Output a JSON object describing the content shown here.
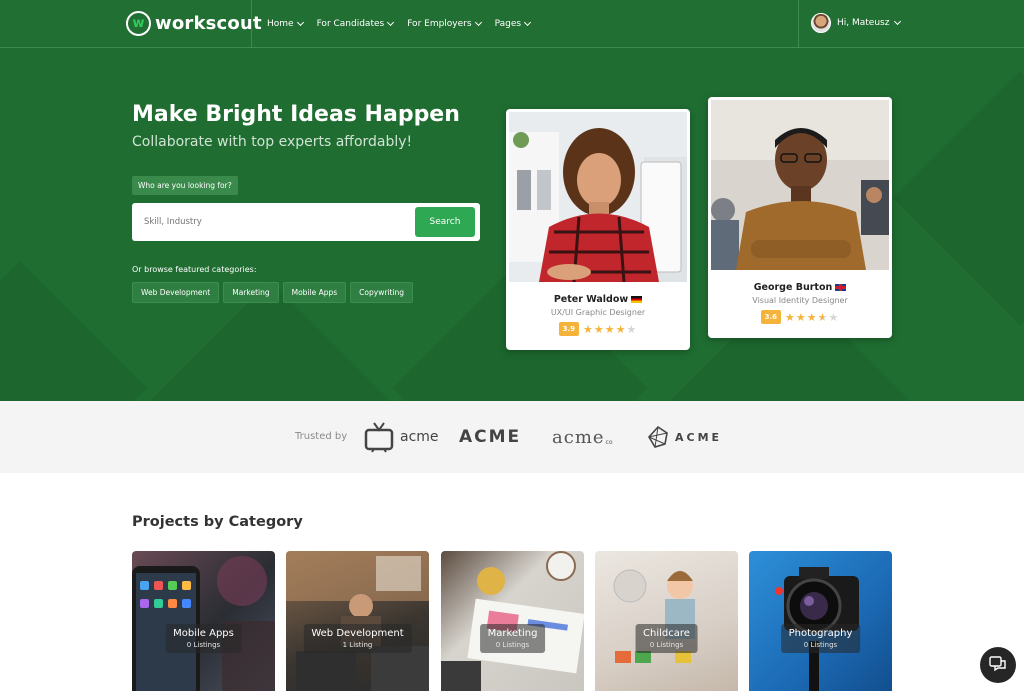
{
  "brand": {
    "name": "workscout",
    "badge_letter": "w"
  },
  "nav": {
    "items": [
      {
        "label": "Home"
      },
      {
        "label": "For Candidates"
      },
      {
        "label": "For Employers"
      },
      {
        "label": "Pages"
      }
    ],
    "user_greeting": "Hi, Mateusz"
  },
  "hero": {
    "title": "Make Bright Ideas Happen",
    "subtitle": "Collaborate with top experts affordably!",
    "search_label": "Who are you looking for?",
    "search_placeholder": "Skill, Industry",
    "search_button": "Search",
    "browse_label": "Or browse featured categories:",
    "categories": [
      "Web Development",
      "Marketing",
      "Mobile Apps",
      "Copywriting"
    ]
  },
  "freelancers": [
    {
      "name": "Peter Waldow",
      "role": "UX/UI Graphic Designer",
      "rating": "3.9",
      "stars": 4,
      "flag": "de-flag-icon"
    },
    {
      "name": "George Burton",
      "role": "Visual Identity Designer",
      "rating": "3.6",
      "stars": 3.5,
      "flag": "uk-flag-icon"
    }
  ],
  "trusted": {
    "label": "Trusted by",
    "logos": [
      "acme",
      "ACME",
      "acme",
      "ACME"
    ]
  },
  "projects": {
    "title": "Projects by Category",
    "items": [
      {
        "name": "Mobile Apps",
        "count": "0 Listings"
      },
      {
        "name": "Web Development",
        "count": "1 Listing"
      },
      {
        "name": "Marketing",
        "count": "0 Listings"
      },
      {
        "name": "Childcare",
        "count": "0 Listings"
      },
      {
        "name": "Photography",
        "count": "0 Listings"
      }
    ]
  },
  "colors": {
    "primary_green": "#1f6d31",
    "accent_green": "#2ea853",
    "star": "#f5b33b"
  },
  "icons": {
    "chat": "chat-bubbles-icon"
  }
}
